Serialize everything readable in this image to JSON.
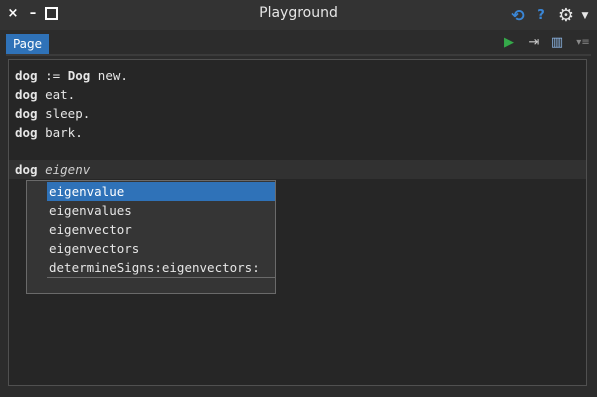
{
  "window": {
    "title": "Playground",
    "close_glyph": "×",
    "minimize_glyph": "–",
    "help_label": "?"
  },
  "tabs": [
    {
      "label": "Page",
      "active": true
    }
  ],
  "editor": {
    "lines": [
      [
        "dog",
        " := ",
        "Dog",
        " new."
      ],
      [
        "dog",
        " eat."
      ],
      [
        "dog",
        " sleep."
      ],
      [
        "dog",
        " bark."
      ]
    ],
    "current_line": {
      "receiver": "dog",
      "typed": "eigenv"
    }
  },
  "completion": {
    "items": [
      {
        "label": "eigenvalue",
        "selected": true
      },
      {
        "label": "eigenvalues",
        "selected": false
      },
      {
        "label": "eigenvector",
        "selected": false
      },
      {
        "label": "eigenvectors",
        "selected": false
      },
      {
        "label": "determineSigns:eigenvectors:",
        "selected": false
      }
    ]
  },
  "colors": {
    "accent": "#2f72b8",
    "run": "#35a94a",
    "background": "#2c2c2c",
    "editor_bg": "#262626"
  },
  "icons": {
    "titlebar": [
      "close-icon",
      "minimize-icon",
      "maximize-icon",
      "sync-icon",
      "help-icon",
      "gear-icon",
      "menu-chevron-icon"
    ],
    "toolbar": [
      "run-icon",
      "export-icon",
      "columns-icon",
      "more-icon"
    ]
  }
}
